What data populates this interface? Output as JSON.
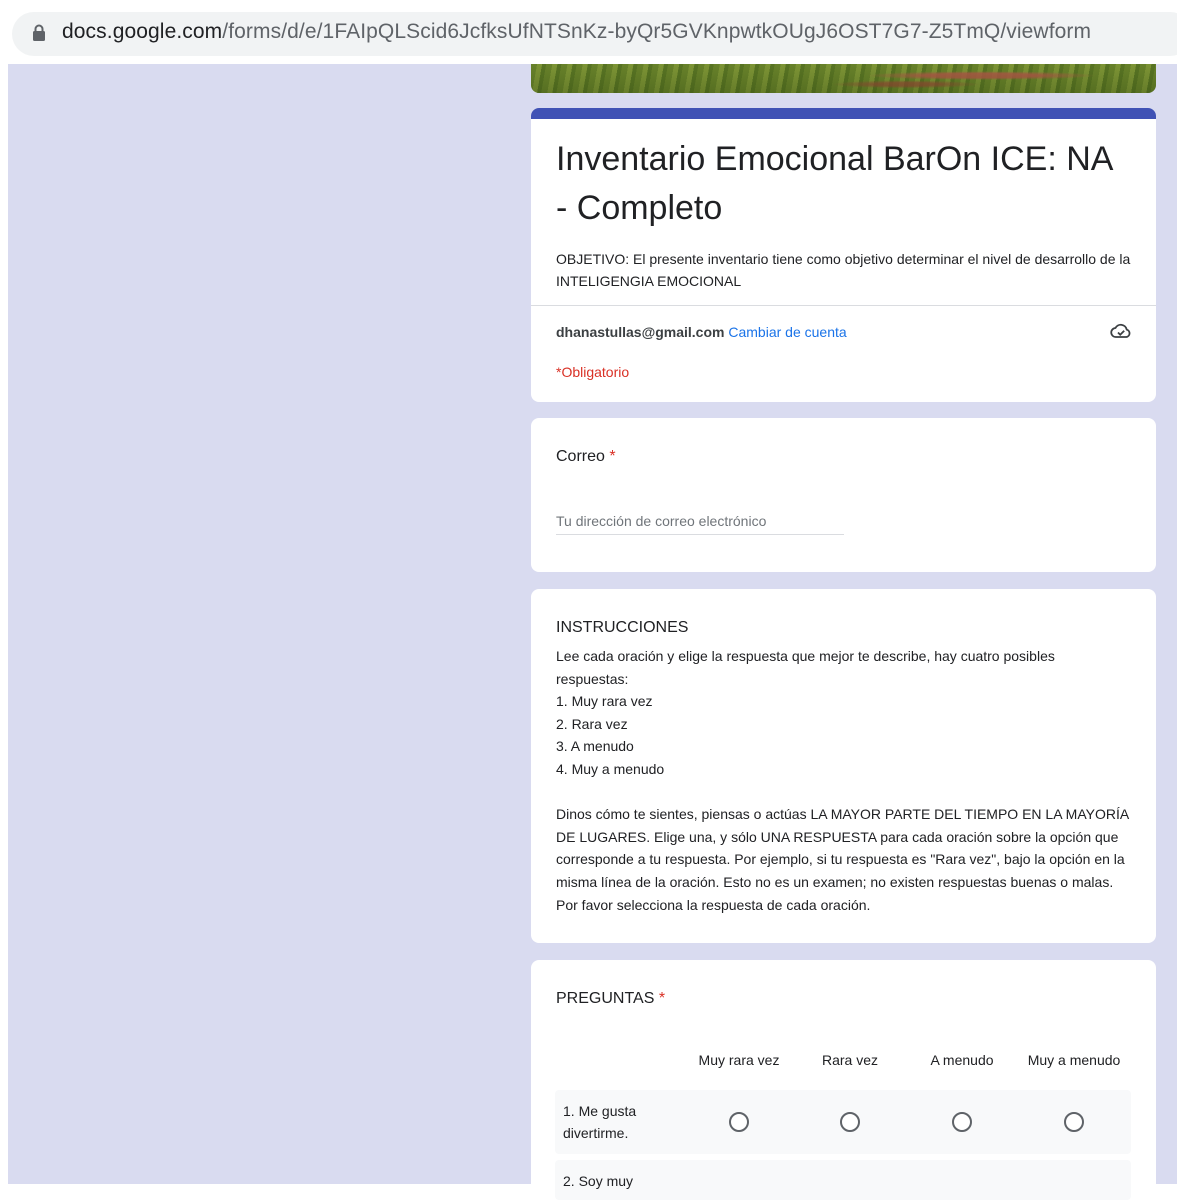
{
  "browser": {
    "url_host": "docs.google.com",
    "url_path": "/forms/d/e/1FAIpQLScid6JcfksUfNTSnKz-byQr5GVKnpwtkOUgJ6OST7G7-Z5TmQ/viewform"
  },
  "form": {
    "title": "Inventario Emocional BarOn ICE: NA - Completo",
    "description": "OBJETIVO: El presente inventario tiene como objetivo determinar el nivel de desarrollo de la INTELIGENGIA EMOCIONAL",
    "account_email": "dhanastullas@gmail.com",
    "switch_account": "Cambiar de cuenta",
    "required_note": "*Obligatorio",
    "accent_color": "#4052b5",
    "background_color": "#d9dbf0"
  },
  "email_question": {
    "title": "Correo",
    "required_mark": "*",
    "placeholder": "Tu dirección de correo electrónico"
  },
  "instructions": {
    "heading": "INSTRUCCIONES",
    "intro_1": "Lee cada oración y elige la respuesta que mejor te describe, hay cuatro posibles",
    "intro_2": "respuestas:",
    "option_1": "1. Muy rara vez",
    "option_2": "2. Rara vez",
    "option_3": "3. A menudo",
    "option_4": "4. Muy a menudo",
    "para_1": "Dinos cómo te sientes, piensas o actúas LA MAYOR PARTE DEL TIEMPO EN LA MAYORÍA",
    "para_2": "DE LUGARES. Elige una, y sólo UNA RESPUESTA para cada oración sobre la opción que",
    "para_3": "corresponde a tu respuesta. Por ejemplo, si tu respuesta es \"Rara vez\", bajo la opción en la",
    "para_4": "misma línea de la oración. Esto no es un examen; no existen respuestas buenas o malas.",
    "para_5": "Por favor selecciona la respuesta de cada oración."
  },
  "grid_question": {
    "title": "PREGUNTAS",
    "required_mark": "*",
    "columns": [
      "Muy rara vez",
      "Rara vez",
      "A menudo",
      "Muy a menudo"
    ],
    "rows": [
      {
        "label_1": "1. Me gusta",
        "label_2": "divertirme."
      },
      {
        "label_1": "2. Soy muy",
        "label_2": ""
      }
    ]
  },
  "icons": {
    "lock": "lock-icon",
    "cloud": "cloud-saved-icon"
  }
}
